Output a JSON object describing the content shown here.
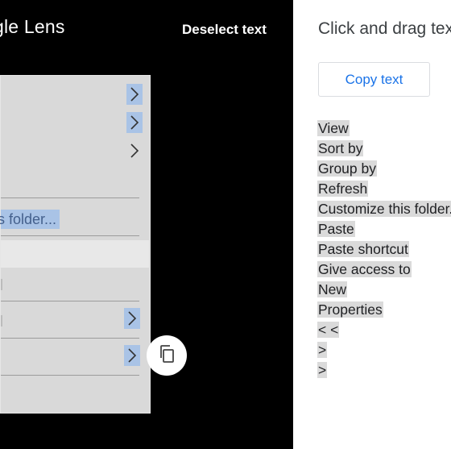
{
  "header": {
    "logo_text": "gle Lens",
    "deselect_label": "Deselect text"
  },
  "menu_screenshot": {
    "folder_item_text": "s folder..."
  },
  "side_panel": {
    "instruction": "Click and drag text",
    "copy_button_label": "Copy text",
    "extracted_lines": [
      "View",
      "Sort by",
      "Group by",
      "Refresh",
      "Customize this folder...",
      "Paste",
      "Paste shortcut",
      "Give access to",
      "New",
      "Properties",
      "< <",
      ">",
      ">"
    ]
  },
  "colors": {
    "dark_background": "#000000",
    "accent": "#1a73e8",
    "text_highlight": "#dadada",
    "selection_highlight": "#a9c3e6"
  }
}
